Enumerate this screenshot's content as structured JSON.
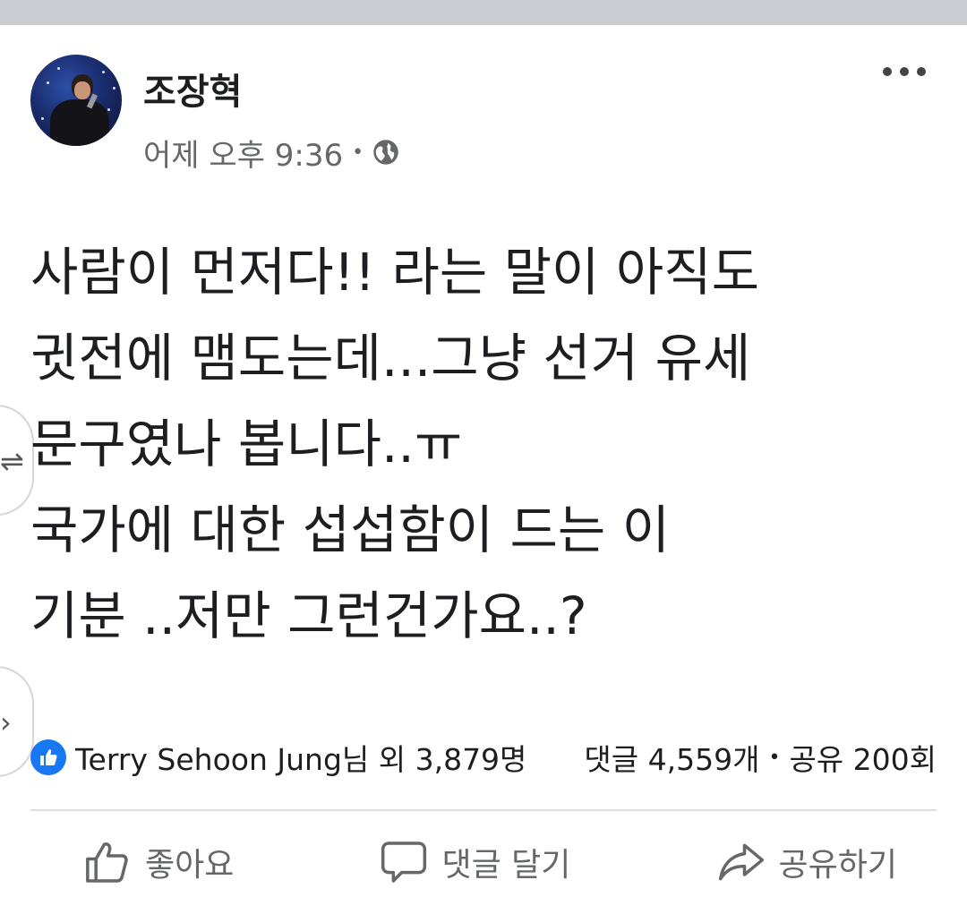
{
  "post": {
    "author": "조장혁",
    "time": "어제 오후 9:36",
    "separator": "•",
    "privacy_icon": "globe-icon",
    "more_icon": "more-options-icon",
    "content_lines": [
      "사람이 먼저다!! 라는 말이 아직도",
      "귓전에 맴도는데...그냥 선거 유세",
      "문구였나 봅니다..ㅠ",
      "국가에 대한 섭섭함이 드는 이",
      "기분 ..저만 그런건가요..?"
    ],
    "reactions": {
      "icon": "like-reaction-icon",
      "text": "Terry Sehoon Jung님 외 3,879명"
    },
    "stats": {
      "comments": "댓글 4,559개",
      "separator": "•",
      "shares": "공유 200회"
    },
    "actions": {
      "like": "좋아요",
      "comment": "댓글 달기",
      "share": "공유하기"
    }
  },
  "colors": {
    "like_blue": "#1877f2",
    "secondary_text": "#65676b",
    "top_strip": "#c9ccd1"
  }
}
